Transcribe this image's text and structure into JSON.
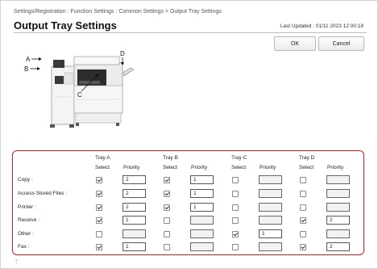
{
  "breadcrumb": "Settings/Registration : Function Settings : Common Settings > Output Tray Settings",
  "page_title": "Output Tray Settings",
  "last_updated": "Last Updated : 01/11 2023 12:00:18",
  "buttons": {
    "ok": "OK",
    "cancel": "Cancel"
  },
  "illustration": {
    "label_a": "A",
    "label_b": "B",
    "label_c": "C",
    "label_d": "D"
  },
  "table": {
    "trays": [
      {
        "name": "Tray A",
        "select": "Select",
        "priority": "Priority"
      },
      {
        "name": "Tray B",
        "select": "Select",
        "priority": "Priority"
      },
      {
        "name": "Tray C",
        "select": "Select",
        "priority": "Priority"
      },
      {
        "name": "Tray D",
        "select": "Select",
        "priority": "Priority"
      }
    ],
    "rows": [
      {
        "label": "Copy :",
        "cells": [
          {
            "checked": true,
            "priority": "2"
          },
          {
            "checked": true,
            "priority": "1"
          },
          {
            "checked": false,
            "priority": ""
          },
          {
            "checked": false,
            "priority": ""
          }
        ]
      },
      {
        "label": "Access Stored Files :",
        "cells": [
          {
            "checked": true,
            "priority": "2"
          },
          {
            "checked": true,
            "priority": "1"
          },
          {
            "checked": false,
            "priority": ""
          },
          {
            "checked": false,
            "priority": ""
          }
        ]
      },
      {
        "label": "Printer :",
        "cells": [
          {
            "checked": true,
            "priority": "2"
          },
          {
            "checked": true,
            "priority": "1"
          },
          {
            "checked": false,
            "priority": ""
          },
          {
            "checked": false,
            "priority": ""
          }
        ]
      },
      {
        "label": "Receive :",
        "cells": [
          {
            "checked": true,
            "priority": "1"
          },
          {
            "checked": false,
            "priority": ""
          },
          {
            "checked": false,
            "priority": ""
          },
          {
            "checked": true,
            "priority": "2"
          }
        ]
      },
      {
        "label": "Other :",
        "cells": [
          {
            "checked": false,
            "priority": ""
          },
          {
            "checked": false,
            "priority": ""
          },
          {
            "checked": true,
            "priority": "1"
          },
          {
            "checked": false,
            "priority": ""
          }
        ]
      },
      {
        "label": "Fax :",
        "cells": [
          {
            "checked": true,
            "priority": "1"
          },
          {
            "checked": false,
            "priority": ""
          },
          {
            "checked": false,
            "priority": ""
          },
          {
            "checked": true,
            "priority": "2"
          }
        ]
      }
    ]
  },
  "colors": {
    "highlight": "#d31b22"
  }
}
